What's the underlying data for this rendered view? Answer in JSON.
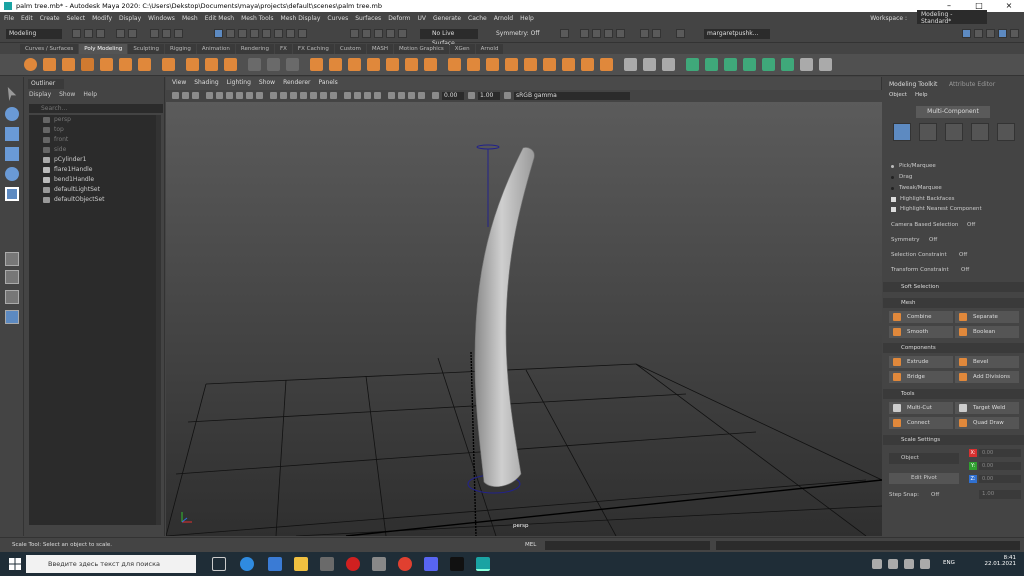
{
  "window": {
    "title": "palm tree.mb* - Autodesk Maya 2020: C:\\Users\\Dekstop\\Documents\\maya\\projects\\default\\scenes\\palm tree.mb"
  },
  "menus": [
    "File",
    "Edit",
    "Create",
    "Select",
    "Modify",
    "Display",
    "Windows",
    "Mesh",
    "Edit Mesh",
    "Mesh Tools",
    "Mesh Display",
    "Curves",
    "Surfaces",
    "Deform",
    "UV",
    "Generate",
    "Cache",
    "Arnold",
    "Help"
  ],
  "workspace": {
    "label": "Workspace :",
    "value": "Modeling - Standard*"
  },
  "status": {
    "mode": "Modeling",
    "live_surface": "No Live Surface",
    "symmetry": "Symmetry: Off",
    "user": "margaretpushk..."
  },
  "shelf_tabs": [
    "Curves / Surfaces",
    "Poly Modeling",
    "Sculpting",
    "Rigging",
    "Animation",
    "Rendering",
    "FX",
    "FX Caching",
    "Custom",
    "MASH",
    "Motion Graphics",
    "XGen",
    "Arnold"
  ],
  "shelf_active": "Poly Modeling",
  "outliner": {
    "tab": "Outliner",
    "menu": [
      "Display",
      "Show",
      "Help"
    ],
    "search_placeholder": "Search...",
    "items": [
      {
        "label": "persp",
        "dim": true
      },
      {
        "label": "top",
        "dim": true
      },
      {
        "label": "front",
        "dim": true
      },
      {
        "label": "side",
        "dim": true
      },
      {
        "label": "pCylinder1",
        "dim": false
      },
      {
        "label": "flare1Handle",
        "dim": false
      },
      {
        "label": "bend1Handle",
        "dim": false
      },
      {
        "label": "defaultLightSet",
        "dim": false
      },
      {
        "label": "defaultObjectSet",
        "dim": false
      }
    ]
  },
  "viewport": {
    "menu": [
      "View",
      "Shading",
      "Lighting",
      "Show",
      "Renderer",
      "Panels"
    ],
    "field1": "0.00",
    "field2": "1.00",
    "colorspace": "sRGB gamma",
    "camera": "persp"
  },
  "modeling_toolkit": {
    "tabs": [
      "Modeling Toolkit",
      "Attribute Editor"
    ],
    "submenu": [
      "Object",
      "Help"
    ],
    "multi_component": "Multi-Component",
    "pick_modes": [
      "Pick/Marquee",
      "Drag",
      "Tweak/Marquee"
    ],
    "checks": [
      "Highlight Backfaces",
      "Highlight Nearest Component"
    ],
    "camera_based": "Camera Based Selection",
    "camera_based_val": "Off",
    "symmetry": "Symmetry",
    "symmetry_val": "Off",
    "sel_constraint": "Selection Constraint",
    "sel_constraint_val": "Off",
    "xform_constraint": "Transform Constraint",
    "xform_constraint_val": "Off",
    "soft_selection": "Soft Selection",
    "mesh": "Mesh",
    "mesh_buttons": [
      "Combine",
      "Separate",
      "Smooth",
      "Boolean"
    ],
    "components": "Components",
    "component_buttons": [
      "Extrude",
      "Bevel",
      "Bridge",
      "Add Divisions"
    ],
    "tools": "Tools",
    "tool_buttons": [
      "Multi-Cut",
      "Target Weld",
      "Connect",
      "Quad Draw"
    ],
    "scale_settings": "Scale Settings",
    "object": "Object",
    "edit_pivot": "Edit Pivot",
    "axes": [
      "X:",
      "Y:",
      "Z:"
    ],
    "axis_val": "0.00",
    "step_snap": "Step Snap:",
    "step_snap_val": "Off",
    "step_val": "1.00"
  },
  "helpline": {
    "text": "Scale Tool: Select an object to scale.",
    "mel": "MEL"
  },
  "taskbar": {
    "search": "Введите здесь текст для поиска",
    "lang": "ENG",
    "time": "8:41",
    "date": "22.01.2021"
  },
  "colors": {
    "accent": "#5d8ac1",
    "shelf_orange": "#e0883b",
    "maya_teal": "#1aa3a3"
  }
}
